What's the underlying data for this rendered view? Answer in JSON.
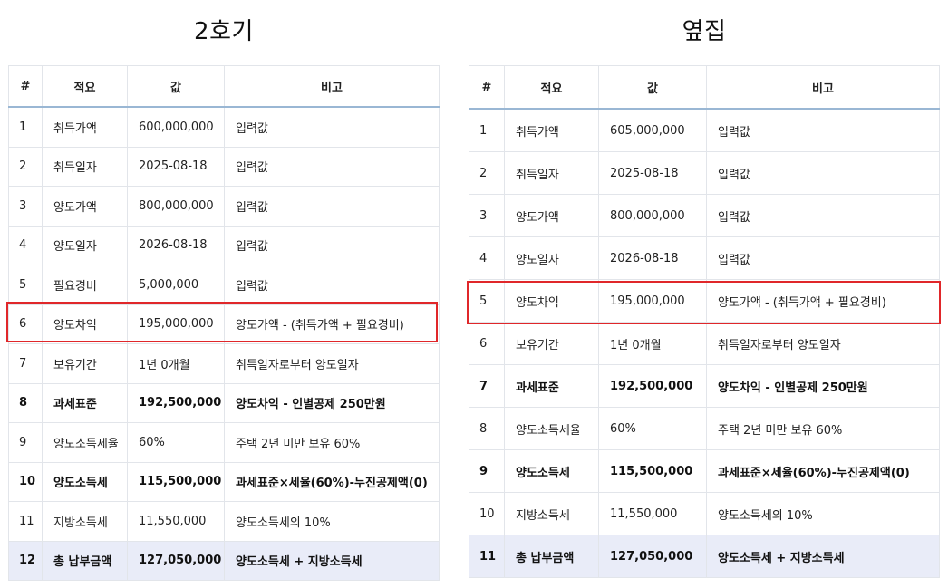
{
  "left": {
    "title": "2호기",
    "headers": [
      "#",
      "적요",
      "값",
      "비고"
    ],
    "rows": [
      {
        "no": "1",
        "item": "취득가액",
        "value": "600,000,000",
        "note": "입력값"
      },
      {
        "no": "2",
        "item": "취득일자",
        "value": "2025-08-18",
        "note": "입력값"
      },
      {
        "no": "3",
        "item": "양도가액",
        "value": "800,000,000",
        "note": "입력값"
      },
      {
        "no": "4",
        "item": "양도일자",
        "value": "2026-08-18",
        "note": "입력값"
      },
      {
        "no": "5",
        "item": "필요경비",
        "value": "5,000,000",
        "note": "입력값"
      },
      {
        "no": "6",
        "item": "양도차익",
        "value": "195,000,000",
        "note": "양도가액 - (취득가액 + 필요경비)"
      },
      {
        "no": "7",
        "item": "보유기간",
        "value": "1년 0개월",
        "note": "취득일자로부터 양도일자"
      },
      {
        "no": "8",
        "item": "과세표준",
        "value": "192,500,000",
        "note": "양도차익 - 인별공제 250만원"
      },
      {
        "no": "9",
        "item": "양도소득세율",
        "value": "60%",
        "note": "주택 2년 미만 보유 60%"
      },
      {
        "no": "10",
        "item": "양도소득세",
        "value": "115,500,000",
        "note": "과세표준×세율(60%)-누진공제액(0)"
      },
      {
        "no": "11",
        "item": "지방소득세",
        "value": "11,550,000",
        "note": "양도소득세의 10%"
      },
      {
        "no": "12",
        "item": "총 납부금액",
        "value": "127,050,000",
        "note": "양도소득세 + 지방소득세"
      }
    ]
  },
  "right": {
    "title": "옆집",
    "headers": [
      "#",
      "적요",
      "값",
      "비고"
    ],
    "rows": [
      {
        "no": "1",
        "item": "취득가액",
        "value": "605,000,000",
        "note": "입력값"
      },
      {
        "no": "2",
        "item": "취득일자",
        "value": "2025-08-18",
        "note": "입력값"
      },
      {
        "no": "3",
        "item": "양도가액",
        "value": "800,000,000",
        "note": "입력값"
      },
      {
        "no": "4",
        "item": "양도일자",
        "value": "2026-08-18",
        "note": "입력값"
      },
      {
        "no": "5",
        "item": "양도차익",
        "value": "195,000,000",
        "note": "양도가액 - (취득가액 + 필요경비)"
      },
      {
        "no": "6",
        "item": "보유기간",
        "value": "1년 0개월",
        "note": "취득일자로부터 양도일자"
      },
      {
        "no": "7",
        "item": "과세표준",
        "value": "192,500,000",
        "note": "양도차익 - 인별공제 250만원"
      },
      {
        "no": "8",
        "item": "양도소득세율",
        "value": "60%",
        "note": "주택 2년 미만 보유 60%"
      },
      {
        "no": "9",
        "item": "양도소득세",
        "value": "115,500,000",
        "note": "과세표준×세율(60%)-누진공제액(0)"
      },
      {
        "no": "10",
        "item": "지방소득세",
        "value": "11,550,000",
        "note": "양도소득세의 10%"
      },
      {
        "no": "11",
        "item": "총 납부금액",
        "value": "127,050,000",
        "note": "양도소득세 + 지방소득세"
      }
    ]
  },
  "colors": {
    "highlight_border": "#e0272a",
    "total_row_bg": "#e9ecf8",
    "header_rule": "#9ab7d4"
  }
}
